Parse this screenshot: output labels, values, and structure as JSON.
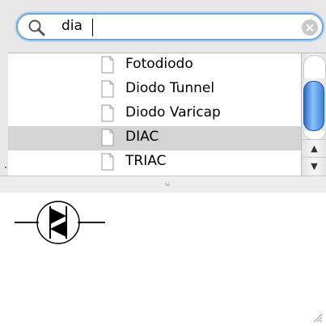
{
  "search": {
    "query": "dia",
    "clear_glyph": "×",
    "icon": "magnifier-icon"
  },
  "results": {
    "items": [
      {
        "label": "Fotodiodo",
        "icon": "document-icon",
        "selected": false
      },
      {
        "label": "Diodo Tunnel",
        "icon": "document-icon",
        "selected": false
      },
      {
        "label": "Diodo Varicap",
        "icon": "document-icon",
        "selected": false
      },
      {
        "label": "DIAC",
        "icon": "document-icon",
        "selected": true
      },
      {
        "label": "TRIAC",
        "icon": "document-icon",
        "selected": false
      }
    ]
  },
  "scrollbar": {
    "up_glyph": "▲",
    "down_glyph": "▼"
  },
  "preview": {
    "symbol": "diac-symbol-icon"
  },
  "colors": {
    "selection": "#d4d4d4",
    "focus_ring": "#6fa6dc",
    "scroll_thumb": "#3f82df"
  }
}
